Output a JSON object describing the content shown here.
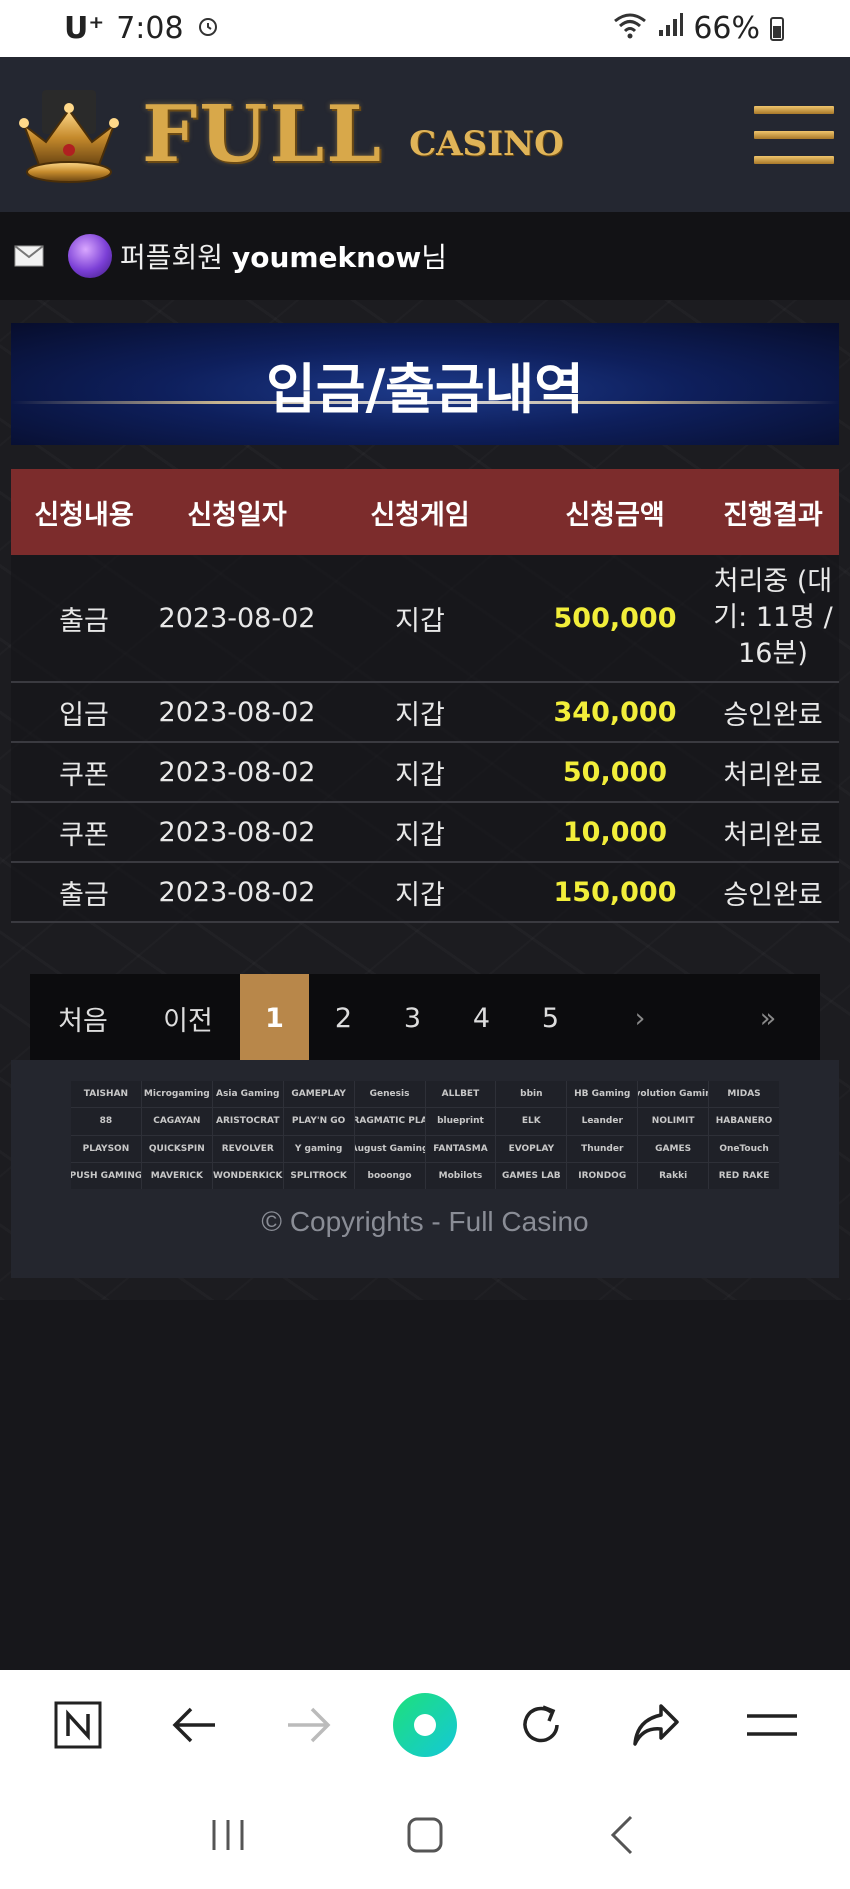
{
  "status_bar": {
    "carrier": "U⁺",
    "time": "7:08",
    "battery": "66%"
  },
  "header": {
    "logo_main": "FULL",
    "logo_sub": "CASINO"
  },
  "user": {
    "grade": "퍼플회원",
    "username": "youmeknow",
    "suffix": "님"
  },
  "banner": {
    "title": "입금/출금내역"
  },
  "table": {
    "headers": [
      "신청내용",
      "신청일자",
      "신청게임",
      "신청금액",
      "진행결과"
    ],
    "rows": [
      {
        "type": "출금",
        "date": "2023-08-02",
        "game": "지갑",
        "amount": "500,000",
        "result": "처리중 (대기: 11명 / 16분)"
      },
      {
        "type": "입금",
        "date": "2023-08-02",
        "game": "지갑",
        "amount": "340,000",
        "result": "승인완료"
      },
      {
        "type": "쿠폰",
        "date": "2023-08-02",
        "game": "지갑",
        "amount": "50,000",
        "result": "처리완료"
      },
      {
        "type": "쿠폰",
        "date": "2023-08-02",
        "game": "지갑",
        "amount": "10,000",
        "result": "처리완료"
      },
      {
        "type": "출금",
        "date": "2023-08-02",
        "game": "지갑",
        "amount": "150,000",
        "result": "승인완료"
      }
    ]
  },
  "pagination": {
    "first": "처음",
    "prev": "이전",
    "pages": [
      "1",
      "2",
      "3",
      "4",
      "5"
    ],
    "active_page": "1",
    "next": "›",
    "last": "»"
  },
  "footer": {
    "providers": [
      "TAISHAN",
      "Microgaming",
      "Asia Gaming",
      "GAMEPLAY",
      "Genesis",
      "ALLBET",
      "bbin",
      "HB Gaming",
      "Evolution Gaming",
      "MIDAS",
      "88",
      "CAGAYAN",
      "ARISTOCRAT",
      "PLAY'N GO",
      "PRAGMATIC PLAY",
      "blueprint",
      "ELK",
      "Leander",
      "NOLIMIT",
      "HABANERO",
      "PLAYSON",
      "QUICKSPIN",
      "REVOLVER",
      "Y gaming",
      "August Gaming",
      "FANTASMA",
      "EVOPLAY",
      "Thunder",
      "GAMES",
      "OneTouch",
      "PUSH GAMING",
      "MAVERICK",
      "WONDERKICK",
      "SPLITROCK",
      "booongo",
      "Mobilots",
      "GAMES LAB",
      "IRONDOG",
      "Rakki",
      "RED RAKE"
    ],
    "copyright": "© Copyrights - Full Casino"
  },
  "colors": {
    "header_bg": "#242731",
    "table_header_bg": "#7c2c2c",
    "amount_color": "#f2ee3a",
    "active_page_bg": "#b8874a",
    "logo_gold": "#d8a84a"
  },
  "icons": {
    "alarm": "alarm-icon",
    "wifi": "wifi-icon",
    "signal": "signal-icon",
    "mail": "mail-icon",
    "menu": "hamburger-icon",
    "nav": [
      "naver-home-icon",
      "back-arrow-icon",
      "forward-arrow-icon",
      "green-dot-icon",
      "refresh-icon",
      "share-icon",
      "menu-icon"
    ],
    "system": [
      "recent-apps-icon",
      "home-icon",
      "back-icon"
    ]
  }
}
